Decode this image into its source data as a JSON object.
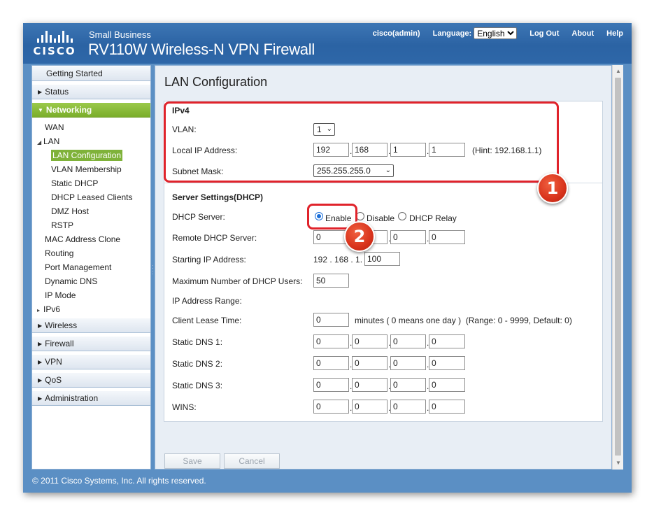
{
  "header": {
    "brand_logo": "CISCO",
    "brand_sub": "Small Business",
    "product": "RV110W Wireless-N VPN Firewall",
    "user": "cisco(admin)",
    "language_label": "Language:",
    "language_value": "English",
    "logout": "Log Out",
    "about": "About",
    "help": "Help"
  },
  "sidebar": {
    "getting_started": "Getting Started",
    "status": "Status",
    "networking": "Networking",
    "networking_items": {
      "wan": "WAN",
      "lan": "LAN",
      "lan_configuration": "LAN Configuration",
      "vlan_membership": "VLAN Membership",
      "static_dhcp": "Static DHCP",
      "dhcp_leased_clients": "DHCP Leased Clients",
      "dmz_host": "DMZ Host",
      "rstp": "RSTP",
      "mac_address_clone": "MAC Address Clone",
      "routing": "Routing",
      "port_management": "Port Management",
      "dynamic_dns": "Dynamic DNS",
      "ip_mode": "IP Mode",
      "ipv6": "IPv6"
    },
    "wireless": "Wireless",
    "firewall": "Firewall",
    "vpn": "VPN",
    "qos": "QoS",
    "administration": "Administration"
  },
  "main": {
    "title": "LAN Configuration",
    "ipv4": {
      "section": "IPv4",
      "vlan_label": "VLAN:",
      "vlan_value": "1",
      "local_ip_label": "Local IP Address:",
      "local_ip": [
        "192",
        "168",
        "1",
        "1"
      ],
      "hint": "(Hint: 192.168.1.1)",
      "subnet_label": "Subnet Mask:",
      "subnet_value": "255.255.255.0"
    },
    "dhcp": {
      "section": "Server Settings(DHCP)",
      "server_label": "DHCP Server:",
      "opt_enable": "Enable",
      "opt_disable": "Disable",
      "opt_relay": "DHCP Relay",
      "selected": "Enable",
      "remote_label": "Remote DHCP Server:",
      "remote": [
        "0",
        "0",
        "0",
        "0"
      ],
      "start_label": "Starting IP Address:",
      "start_prefix": "192 . 168 . 1.",
      "start_last": "100",
      "max_label": "Maximum Number of DHCP Users:",
      "max_value": "50",
      "range_label": "IP Address Range:",
      "lease_label": "Client Lease Time:",
      "lease_value": "0",
      "lease_note": "minutes ( 0 means one day )  (Range: 0 - 9999, Default: 0)",
      "dns1_label": "Static DNS 1:",
      "dns1": [
        "0",
        "0",
        "0",
        "0"
      ],
      "dns2_label": "Static DNS 2:",
      "dns2": [
        "0",
        "0",
        "0",
        "0"
      ],
      "dns3_label": "Static DNS 3:",
      "dns3": [
        "0",
        "0",
        "0",
        "0"
      ],
      "wins_label": "WINS:",
      "wins": [
        "0",
        "0",
        "0",
        "0"
      ]
    },
    "save": "Save",
    "cancel": "Cancel"
  },
  "annotations": {
    "one": "1",
    "two": "2",
    "color": "#e0232b"
  },
  "footer": "© 2011 Cisco Systems, Inc. All rights reserved."
}
